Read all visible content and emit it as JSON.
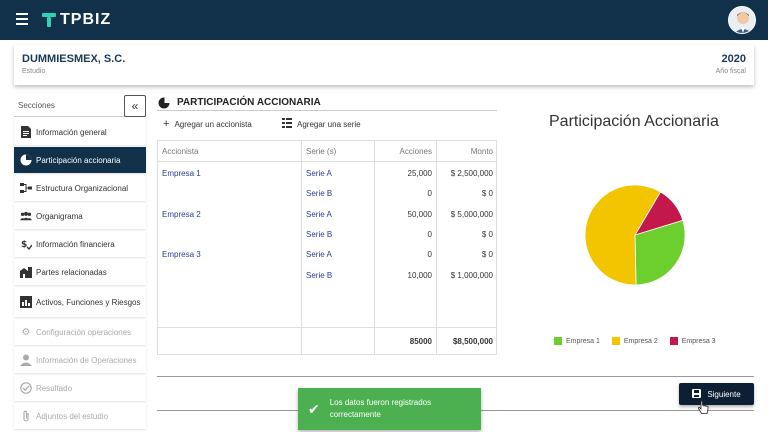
{
  "app": {
    "brand": "TPBIZ"
  },
  "company": {
    "name": "DUMMIESMEX, S.C.",
    "subtitle": "Estudio",
    "year": "2020",
    "year_label": "Año fiscal"
  },
  "sidebar": {
    "title": "Secciones",
    "collapse_glyph": "«",
    "items": [
      {
        "label": "Información general",
        "icon": "document-icon",
        "state": "normal"
      },
      {
        "label": "Participación accionaria",
        "icon": "pie-chart-icon",
        "state": "active"
      },
      {
        "label": "Estructura Organizacional",
        "icon": "org-structure-icon",
        "state": "normal"
      },
      {
        "label": "Organigrama",
        "icon": "people-icon",
        "state": "normal"
      },
      {
        "label": "Información financiera",
        "icon": "money-icon",
        "state": "normal"
      },
      {
        "label": "Partes relacionadas",
        "icon": "buildings-icon",
        "state": "normal"
      },
      {
        "label": "Activos, Funciones y Riesgos",
        "icon": "bar-chart-icon",
        "state": "normal"
      },
      {
        "label": "Configuración operaciones",
        "icon": "gears-icon",
        "state": "disabled"
      },
      {
        "label": "Información de Operaciones",
        "icon": "person-icon",
        "state": "disabled"
      },
      {
        "label": "Resultado",
        "icon": "check-circle-icon",
        "state": "disabled"
      },
      {
        "label": "Adjuntos del estudio",
        "icon": "paperclip-icon",
        "state": "disabled"
      }
    ]
  },
  "panel": {
    "title": "PARTICIPACIÓN ACCIONARIA",
    "add_shareholder": "Agregar un accionista",
    "add_series": "Agregar una serie",
    "columns": [
      "Accionista",
      "Serie (s)",
      "Acciones",
      "Monto"
    ],
    "rows": [
      {
        "accionista": "Empresa 1",
        "serie": "Serie A",
        "acciones": "25,000",
        "monto": "$ 2,500,000"
      },
      {
        "accionista": "",
        "serie": "Serie B",
        "acciones": "0",
        "monto": "$ 0"
      },
      {
        "accionista": "Empresa 2",
        "serie": "Serie A",
        "acciones": "50,000",
        "monto": "$ 5,000,000"
      },
      {
        "accionista": "",
        "serie": "Serie B",
        "acciones": "0",
        "monto": "$ 0"
      },
      {
        "accionista": "Empresa 3",
        "serie": "Serie A",
        "acciones": "0",
        "monto": "$ 0"
      },
      {
        "accionista": "",
        "serie": "Serie B",
        "acciones": "10,000",
        "monto": "$ 1,000,000"
      }
    ],
    "total_acciones": "85000",
    "total_monto": "$8,500,000"
  },
  "chart_data": {
    "type": "pie",
    "title": "Participación Accionaria",
    "categories": [
      "Empresa 1",
      "Empresa 2",
      "Empresa 3"
    ],
    "values": [
      25000,
      50000,
      10000
    ],
    "colors": [
      "#6ccf2e",
      "#f2c500",
      "#c2184c"
    ],
    "legend_position": "bottom"
  },
  "actions": {
    "next_label": "Siguiente"
  },
  "toast": {
    "message": "Los datos fueron registrados correctamente"
  }
}
